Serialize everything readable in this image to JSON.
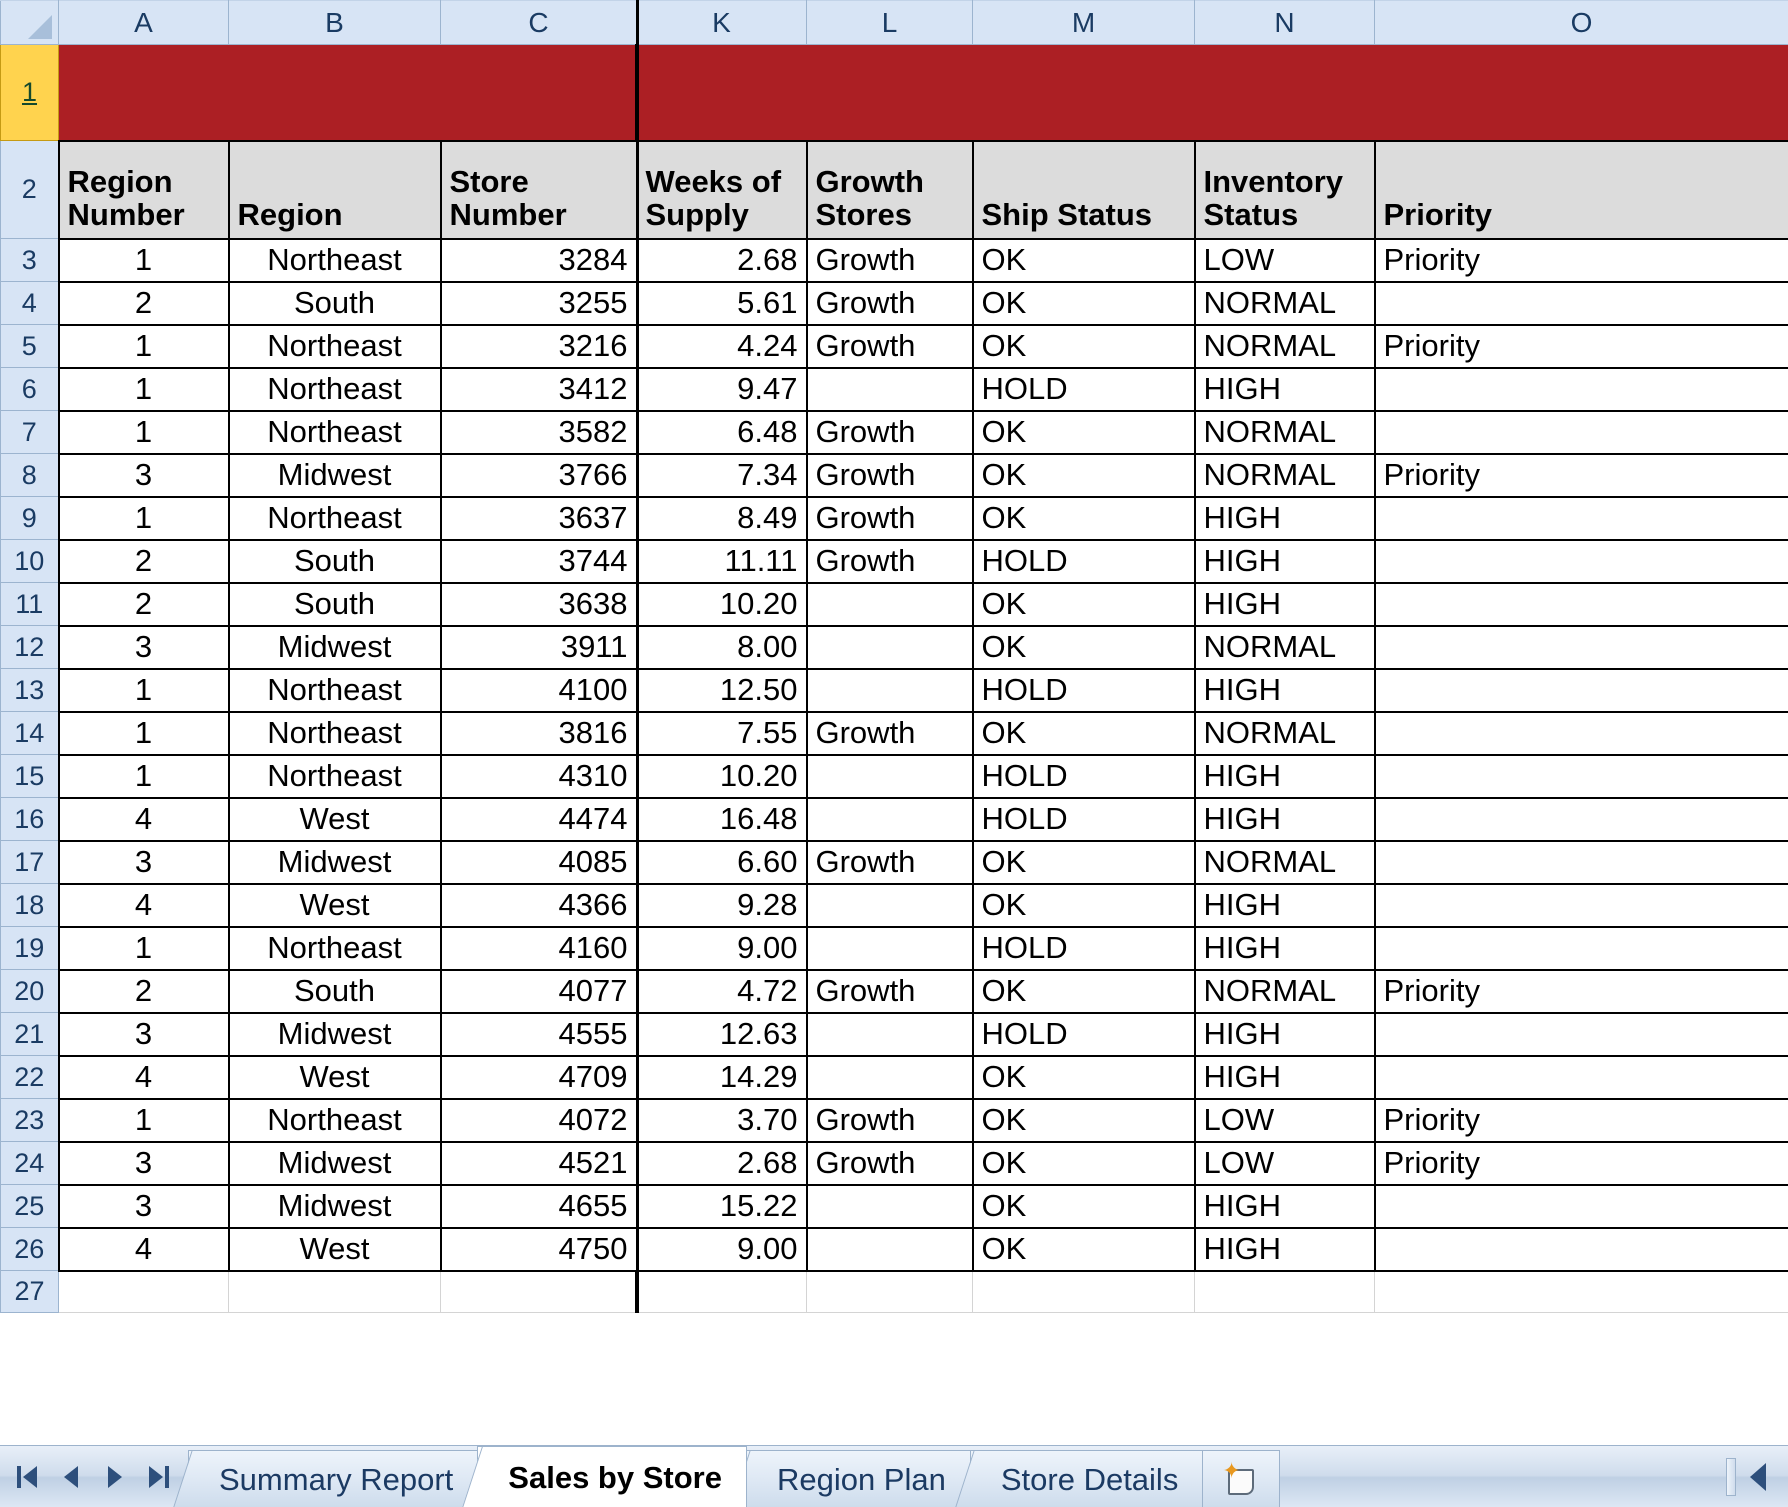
{
  "spreadsheet": {
    "corner_label": "select-all",
    "column_letters": [
      "A",
      "B",
      "C",
      "K",
      "L",
      "M",
      "N",
      "O"
    ],
    "selected_row_header": "1",
    "banner_row_number": "1",
    "header_row_number": "2",
    "trailing_row_number": "27",
    "banner_color": "#ac1f24",
    "header_fill": "#dcdcdc",
    "rowheader_fill": "#d7e4f5",
    "selected_rowheader_fill": "#ffd34e",
    "columns": [
      {
        "letter": "A",
        "header": "Region Number"
      },
      {
        "letter": "B",
        "header": "Region"
      },
      {
        "letter": "C",
        "header": "Store Number"
      },
      {
        "letter": "K",
        "header": "Weeks of Supply"
      },
      {
        "letter": "L",
        "header": "Growth Stores"
      },
      {
        "letter": "M",
        "header": "Ship Status"
      },
      {
        "letter": "N",
        "header": "Inventory Status"
      },
      {
        "letter": "O",
        "header": "Priority"
      }
    ],
    "header_lines": {
      "A": [
        "Region",
        "Number"
      ],
      "B": [
        "Region"
      ],
      "C": [
        "Store",
        "Number"
      ],
      "K": [
        "Weeks of",
        "Supply"
      ],
      "L": [
        "Growth",
        "Stores"
      ],
      "M": [
        "Ship Status"
      ],
      "N": [
        "Inventory",
        "Status"
      ],
      "O": [
        "Priority"
      ]
    },
    "rows": [
      {
        "n": "3",
        "A": "1",
        "B": "Northeast",
        "C": "3284",
        "K": "2.68",
        "L": "Growth",
        "M": "OK",
        "N": "LOW",
        "O": "Priority"
      },
      {
        "n": "4",
        "A": "2",
        "B": "South",
        "C": "3255",
        "K": "5.61",
        "L": "Growth",
        "M": "OK",
        "N": "NORMAL",
        "O": ""
      },
      {
        "n": "5",
        "A": "1",
        "B": "Northeast",
        "C": "3216",
        "K": "4.24",
        "L": "Growth",
        "M": "OK",
        "N": "NORMAL",
        "O": "Priority"
      },
      {
        "n": "6",
        "A": "1",
        "B": "Northeast",
        "C": "3412",
        "K": "9.47",
        "L": "",
        "M": "HOLD",
        "N": "HIGH",
        "O": ""
      },
      {
        "n": "7",
        "A": "1",
        "B": "Northeast",
        "C": "3582",
        "K": "6.48",
        "L": "Growth",
        "M": "OK",
        "N": "NORMAL",
        "O": ""
      },
      {
        "n": "8",
        "A": "3",
        "B": "Midwest",
        "C": "3766",
        "K": "7.34",
        "L": "Growth",
        "M": "OK",
        "N": "NORMAL",
        "O": "Priority"
      },
      {
        "n": "9",
        "A": "1",
        "B": "Northeast",
        "C": "3637",
        "K": "8.49",
        "L": "Growth",
        "M": "OK",
        "N": "HIGH",
        "O": ""
      },
      {
        "n": "10",
        "A": "2",
        "B": "South",
        "C": "3744",
        "K": "11.11",
        "L": "Growth",
        "M": "HOLD",
        "N": "HIGH",
        "O": ""
      },
      {
        "n": "11",
        "A": "2",
        "B": "South",
        "C": "3638",
        "K": "10.20",
        "L": "",
        "M": "OK",
        "N": "HIGH",
        "O": ""
      },
      {
        "n": "12",
        "A": "3",
        "B": "Midwest",
        "C": "3911",
        "K": "8.00",
        "L": "",
        "M": "OK",
        "N": "NORMAL",
        "O": ""
      },
      {
        "n": "13",
        "A": "1",
        "B": "Northeast",
        "C": "4100",
        "K": "12.50",
        "L": "",
        "M": "HOLD",
        "N": "HIGH",
        "O": ""
      },
      {
        "n": "14",
        "A": "1",
        "B": "Northeast",
        "C": "3816",
        "K": "7.55",
        "L": "Growth",
        "M": "OK",
        "N": "NORMAL",
        "O": ""
      },
      {
        "n": "15",
        "A": "1",
        "B": "Northeast",
        "C": "4310",
        "K": "10.20",
        "L": "",
        "M": "HOLD",
        "N": "HIGH",
        "O": ""
      },
      {
        "n": "16",
        "A": "4",
        "B": "West",
        "C": "4474",
        "K": "16.48",
        "L": "",
        "M": "HOLD",
        "N": "HIGH",
        "O": ""
      },
      {
        "n": "17",
        "A": "3",
        "B": "Midwest",
        "C": "4085",
        "K": "6.60",
        "L": "Growth",
        "M": "OK",
        "N": "NORMAL",
        "O": ""
      },
      {
        "n": "18",
        "A": "4",
        "B": "West",
        "C": "4366",
        "K": "9.28",
        "L": "",
        "M": "OK",
        "N": "HIGH",
        "O": ""
      },
      {
        "n": "19",
        "A": "1",
        "B": "Northeast",
        "C": "4160",
        "K": "9.00",
        "L": "",
        "M": "HOLD",
        "N": "HIGH",
        "O": ""
      },
      {
        "n": "20",
        "A": "2",
        "B": "South",
        "C": "4077",
        "K": "4.72",
        "L": "Growth",
        "M": "OK",
        "N": "NORMAL",
        "O": "Priority"
      },
      {
        "n": "21",
        "A": "3",
        "B": "Midwest",
        "C": "4555",
        "K": "12.63",
        "L": "",
        "M": "HOLD",
        "N": "HIGH",
        "O": ""
      },
      {
        "n": "22",
        "A": "4",
        "B": "West",
        "C": "4709",
        "K": "14.29",
        "L": "",
        "M": "OK",
        "N": "HIGH",
        "O": ""
      },
      {
        "n": "23",
        "A": "1",
        "B": "Northeast",
        "C": "4072",
        "K": "3.70",
        "L": "Growth",
        "M": "OK",
        "N": "LOW",
        "O": "Priority"
      },
      {
        "n": "24",
        "A": "3",
        "B": "Midwest",
        "C": "4521",
        "K": "2.68",
        "L": "Growth",
        "M": "OK",
        "N": "LOW",
        "O": "Priority"
      },
      {
        "n": "25",
        "A": "3",
        "B": "Midwest",
        "C": "4655",
        "K": "15.22",
        "L": "",
        "M": "OK",
        "N": "HIGH",
        "O": ""
      },
      {
        "n": "26",
        "A": "4",
        "B": "West",
        "C": "4750",
        "K": "9.00",
        "L": "",
        "M": "OK",
        "N": "HIGH",
        "O": ""
      }
    ]
  },
  "tabbar": {
    "nav": {
      "first": "first-sheet",
      "prev": "previous-sheet",
      "next": "next-sheet",
      "last": "last-sheet"
    },
    "tabs": [
      {
        "label": "Summary Report",
        "active": false
      },
      {
        "label": "Sales by Store",
        "active": true
      },
      {
        "label": "Region Plan",
        "active": false
      },
      {
        "label": "Store Details",
        "active": false
      }
    ],
    "insert_sheet_icon": "insert-worksheet-icon",
    "scroll_left_icon": "scroll-left-icon"
  }
}
